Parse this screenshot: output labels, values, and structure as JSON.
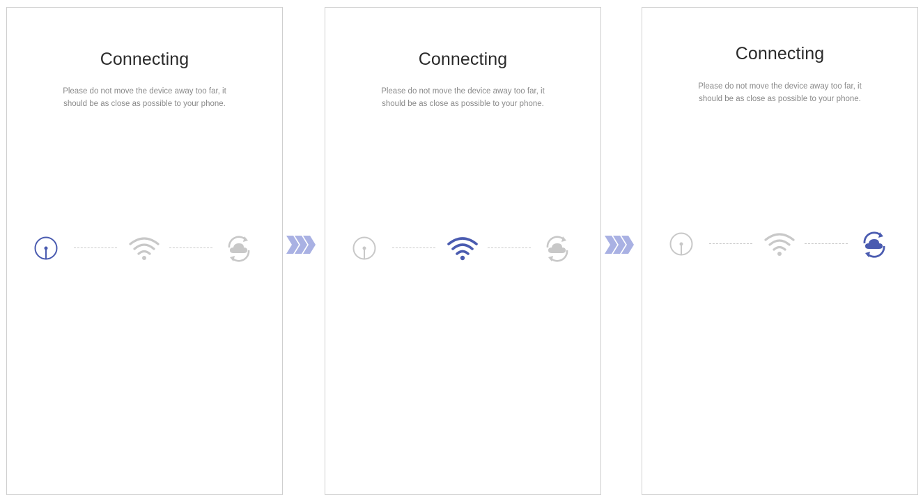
{
  "screens": [
    {
      "title": "Connecting",
      "desc_line1": "Please do not move the device away too far, it",
      "desc_line2": "should be as close as possible to your phone.",
      "active_step": "device"
    },
    {
      "title": "Connecting",
      "desc_line1": "Please do not move the device away too far, it",
      "desc_line2": "should be as close as possible to your phone.",
      "active_step": "wifi"
    },
    {
      "title": "Connecting",
      "desc_line1": "Please do not move the device away too far, it",
      "desc_line2": "should be as close as possible to your phone.",
      "active_step": "cloud"
    }
  ],
  "icons": [
    "device-icon",
    "wifi-icon",
    "cloud-sync-icon",
    "forward-arrows-icon"
  ],
  "colors": {
    "active": "#4a5bb0",
    "inactive": "#c8c8c8",
    "arrow": "#a9b1e3",
    "title": "#2b2b2b",
    "desc": "#8a8a8a"
  }
}
